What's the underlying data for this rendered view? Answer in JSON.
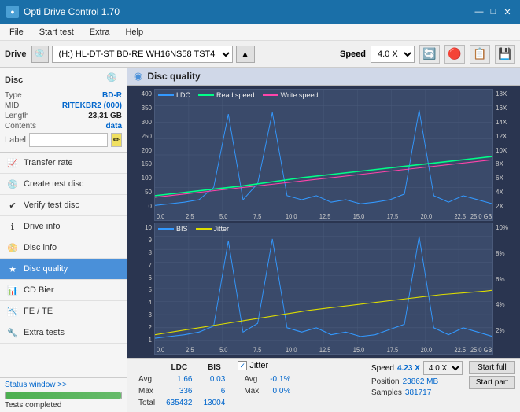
{
  "titleBar": {
    "title": "Opti Drive Control 1.70",
    "icon": "●",
    "minimize": "—",
    "maximize": "□",
    "close": "✕"
  },
  "menuBar": {
    "items": [
      "File",
      "Start test",
      "Extra",
      "Help"
    ]
  },
  "toolbar": {
    "driveLabel": "Drive",
    "driveValue": "(H:)  HL-DT-ST BD-RE  WH16NS58 TST4",
    "speedLabel": "Speed",
    "speedValue": "4.0 X"
  },
  "disc": {
    "title": "Disc",
    "type_label": "Type",
    "type_value": "BD-R",
    "mid_label": "MID",
    "mid_value": "RITEKBR2 (000)",
    "length_label": "Length",
    "length_value": "23,31 GB",
    "contents_label": "Contents",
    "contents_value": "data",
    "label_label": "Label",
    "label_value": ""
  },
  "navItems": [
    {
      "id": "transfer-rate",
      "label": "Transfer rate",
      "icon": "📈"
    },
    {
      "id": "create-test-disc",
      "label": "Create test disc",
      "icon": "💿"
    },
    {
      "id": "verify-test-disc",
      "label": "Verify test disc",
      "icon": "✔"
    },
    {
      "id": "drive-info",
      "label": "Drive info",
      "icon": "ℹ"
    },
    {
      "id": "disc-info",
      "label": "Disc info",
      "icon": "📀"
    },
    {
      "id": "disc-quality",
      "label": "Disc quality",
      "icon": "★",
      "active": true
    },
    {
      "id": "cd-bier",
      "label": "CD Bier",
      "icon": "📊"
    },
    {
      "id": "fe-te",
      "label": "FE / TE",
      "icon": "📉"
    },
    {
      "id": "extra-tests",
      "label": "Extra tests",
      "icon": "🔧"
    }
  ],
  "statusBar": {
    "btn": "Status window >>",
    "progress": 100,
    "text": "Tests completed"
  },
  "chartHeader": {
    "icon": "◉",
    "title": "Disc quality"
  },
  "chart1": {
    "title": "LDC chart",
    "legend": [
      {
        "label": "LDC",
        "color": "#3399ff"
      },
      {
        "label": "Read speed",
        "color": "#00ff88"
      },
      {
        "label": "Write speed",
        "color": "#ff44aa"
      }
    ],
    "yLabels": [
      "400",
      "350",
      "300",
      "250",
      "200",
      "150",
      "100",
      "50",
      "0"
    ],
    "yLabelsRight": [
      "18X",
      "16X",
      "14X",
      "12X",
      "10X",
      "8X",
      "6X",
      "4X",
      "2X"
    ],
    "xLabels": [
      "0.0",
      "2.5",
      "5.0",
      "7.5",
      "10.0",
      "12.5",
      "15.0",
      "17.5",
      "20.0",
      "22.5",
      "25.0 GB"
    ]
  },
  "chart2": {
    "title": "BIS chart",
    "legend": [
      {
        "label": "BIS",
        "color": "#3399ff"
      },
      {
        "label": "Jitter",
        "color": "#dddd00"
      }
    ],
    "yLabels": [
      "10",
      "9",
      "8",
      "7",
      "6",
      "5",
      "4",
      "3",
      "2",
      "1"
    ],
    "yLabelsRight": [
      "10%",
      "8%",
      "6%",
      "4%",
      "2%"
    ],
    "xLabels": [
      "0.0",
      "2.5",
      "5.0",
      "7.5",
      "10.0",
      "12.5",
      "15.0",
      "17.5",
      "20.0",
      "22.5",
      "25.0 GB"
    ]
  },
  "stats": {
    "columns": [
      "LDC",
      "BIS"
    ],
    "rows": [
      {
        "label": "Avg",
        "ldc": "1.66",
        "bis": "0.03"
      },
      {
        "label": "Max",
        "ldc": "336",
        "bis": "6"
      },
      {
        "label": "Total",
        "ldc": "635432",
        "bis": "13004"
      }
    ],
    "jitter_label": "Jitter",
    "jitter_checked": true,
    "jitter_rows": [
      {
        "label": "Avg",
        "val": "-0.1%"
      },
      {
        "label": "Max",
        "val": "0.0%"
      },
      {
        "label": "",
        "val": ""
      }
    ],
    "speed_label": "Speed",
    "speed_val": "4.23 X",
    "speed_select": "4.0 X",
    "position_label": "Position",
    "position_val": "23862 MB",
    "samples_label": "Samples",
    "samples_val": "381717",
    "btn_full": "Start full",
    "btn_part": "Start part"
  }
}
